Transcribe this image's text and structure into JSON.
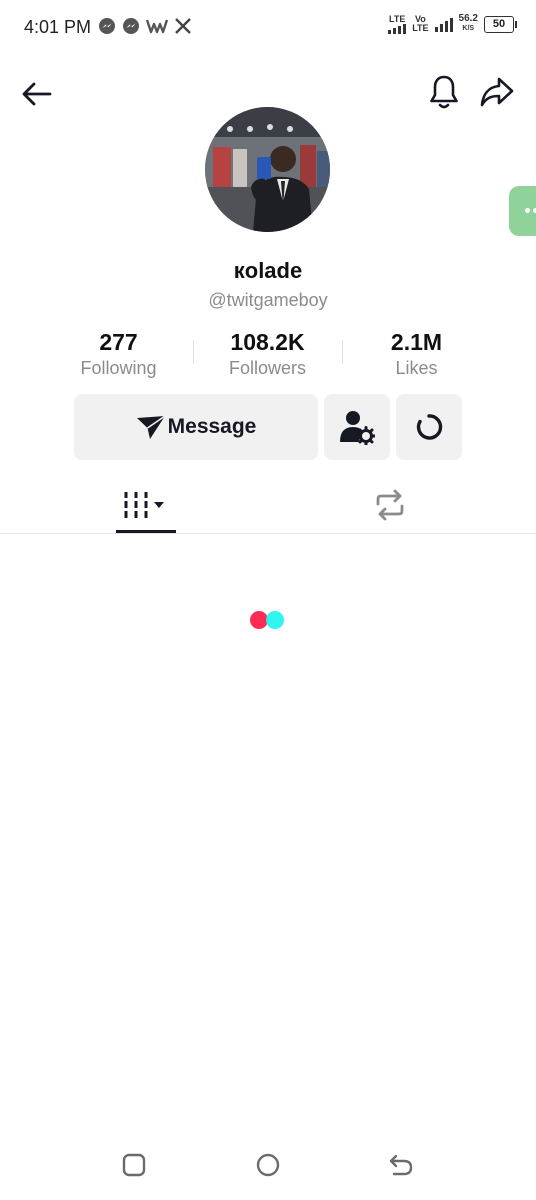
{
  "status_bar": {
    "time": "4:01 PM",
    "notification_icons": [
      "messenger-icon",
      "messenger-icon",
      "w-app-icon",
      "x-icon"
    ],
    "network_1": "LTE",
    "network_2_top": "Vo",
    "network_2_bottom": "LTE",
    "speed_value": "56.2",
    "speed_unit": "K/S",
    "battery": "50"
  },
  "profile": {
    "display_name": "кolade",
    "username": "@twitgameboy"
  },
  "stats": [
    {
      "value": "277",
      "label": "Following"
    },
    {
      "value": "108.2K",
      "label": "Followers"
    },
    {
      "value": "2.1M",
      "label": "Likes"
    }
  ],
  "actions": {
    "message_label": "Message"
  },
  "colors": {
    "loader_red": "#fe2c55",
    "loader_cyan": "#25f4ee",
    "side_tab_green": "#8fd29a"
  }
}
